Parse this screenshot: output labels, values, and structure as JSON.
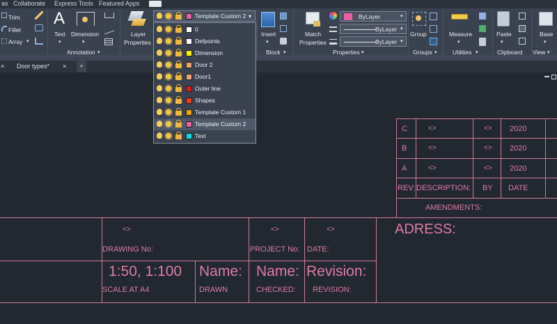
{
  "menu": {
    "items": [
      "as",
      "Collaborate",
      "Express Tools",
      "Featured Apps"
    ]
  },
  "ribbon": {
    "modify": {
      "trim": "Trim",
      "fillet": "Fillet",
      "array": "Array"
    },
    "annotation": {
      "text": "Text",
      "dimension": "Dimension",
      "panel_title": "Annotation"
    },
    "layers": {
      "layer_properties_line1": "Layer",
      "layer_properties_line2": "Properties",
      "current_layer": "Template Custom 2",
      "current_color": "#ea5fa0"
    },
    "block": {
      "insert": "Insert",
      "panel_title": "Block"
    },
    "properties": {
      "match_line1": "Match",
      "match_line2": "Properties",
      "color_value": "ByLayer",
      "color_swatch": "#ea5fa0",
      "linetype_value": "ByLayer",
      "lineweight_value": "ByLayer",
      "panel_title": "Properties"
    },
    "groups": {
      "group": "Group",
      "panel_title": "Groups"
    },
    "utilities": {
      "measure": "Measure",
      "panel_title": "Utilities"
    },
    "clipboard": {
      "paste": "Paste",
      "panel_title": "Clipboard"
    },
    "view": {
      "base": "Base",
      "panel_title": "View"
    }
  },
  "layer_list": [
    {
      "name": "0",
      "color": "#ffffff"
    },
    {
      "name": "Defpoints",
      "color": "#ffffff"
    },
    {
      "name": "Dimension",
      "color": "#ffee00"
    },
    {
      "name": "Door 2",
      "color": "#f5a36b"
    },
    {
      "name": "Door1",
      "color": "#f2a070"
    },
    {
      "name": "Outer line",
      "color": "#e01818"
    },
    {
      "name": "Shapes",
      "color": "#ef3b1a"
    },
    {
      "name": "Template Custom 1",
      "color": "#f2a400"
    },
    {
      "name": "Template Custom 2",
      "color": "#ea5fa0",
      "selected": true
    },
    {
      "name": "Text",
      "color": "#00e0e8"
    }
  ],
  "tabs": {
    "drawing_tab": "Door types*",
    "close_glyph": "×",
    "add_glyph": "+"
  },
  "title_block": {
    "revisions": [
      {
        "rev": "C",
        "desc": "<>",
        "by": "<>",
        "date": "2020"
      },
      {
        "rev": "B",
        "desc": "<>",
        "by": "<>",
        "date": "2020"
      },
      {
        "rev": "A",
        "desc": "<>",
        "by": "<>",
        "date": "2020"
      }
    ],
    "header": {
      "rev": "REV:",
      "desc": "DESCRIPTION:",
      "by": "BY",
      "date": "DATE"
    },
    "amendments": "AMENDMENTS:",
    "address": "ADRESS:",
    "drawing_no_value": "<>",
    "drawing_no": "DRAWING No:",
    "project_no_value": "<>",
    "project_no": "PROJECT No:",
    "date_value": "<>",
    "date_label": "DATE:",
    "scale_value": "1:50, 1:100",
    "scale_label": "SCALE AT A4",
    "drawn_value": "Name:",
    "drawn_label": "DRAWN",
    "checked_value": "Name:",
    "checked_label": "CHECKED:",
    "revision_value": "Revision:",
    "revision_label": "REVISION:"
  }
}
